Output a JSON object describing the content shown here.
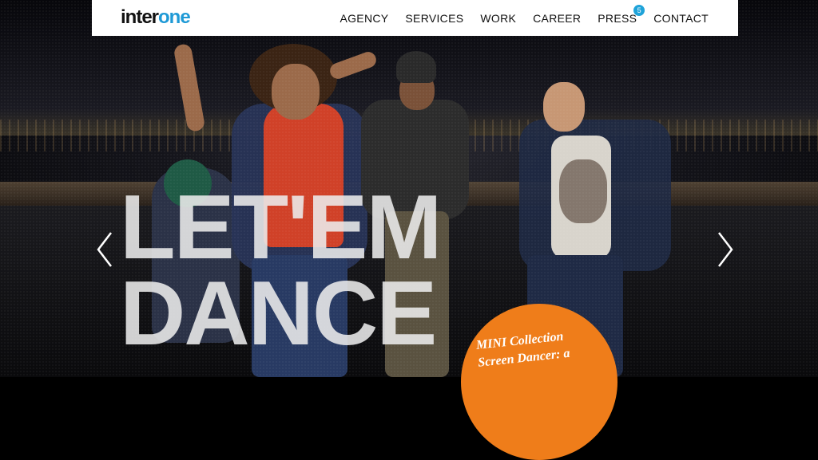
{
  "brand": {
    "logo_part1": "inter",
    "logo_part2": "one",
    "accent_color": "#1f9ad6"
  },
  "nav": {
    "items": [
      {
        "label": "AGENCY"
      },
      {
        "label": "SERVICES"
      },
      {
        "label": "WORK"
      },
      {
        "label": "CAREER"
      },
      {
        "label": "PRESS",
        "badge": "5"
      },
      {
        "label": "CONTACT"
      }
    ]
  },
  "hero": {
    "headline_line1": "LET'EM",
    "headline_line2": "DANCE",
    "prev_icon": "chevron-left-icon",
    "next_icon": "chevron-right-icon"
  },
  "promo": {
    "color": "#ef7d1a",
    "line1": "MINI Collection",
    "line2": "Screen Dancer: a"
  }
}
